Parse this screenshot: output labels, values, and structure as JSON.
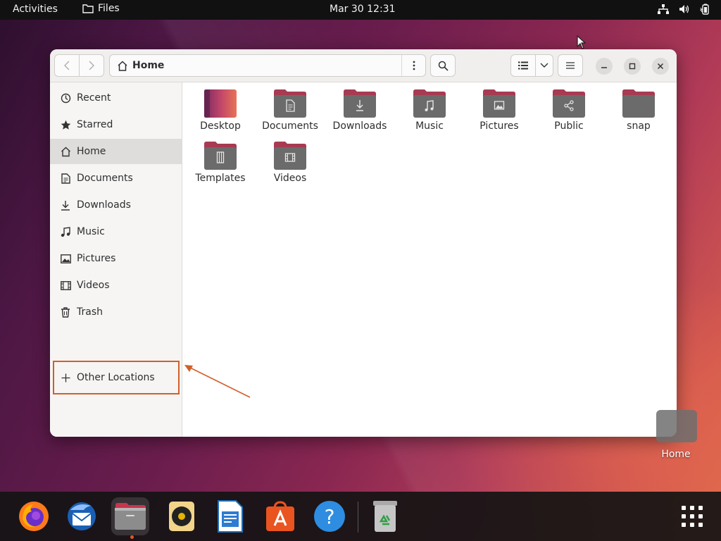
{
  "topbar": {
    "activities": "Activities",
    "app_name": "Files",
    "clock": "Mar 30  12:31",
    "tray_icons": [
      "network-icon",
      "volume-icon",
      "battery-icon"
    ]
  },
  "window": {
    "path": "Home",
    "sidebar": [
      {
        "label": "Recent",
        "icon": "clock-icon"
      },
      {
        "label": "Starred",
        "icon": "star-icon"
      },
      {
        "label": "Home",
        "icon": "home-icon",
        "active": true
      },
      {
        "label": "Documents",
        "icon": "document-icon"
      },
      {
        "label": "Downloads",
        "icon": "download-icon"
      },
      {
        "label": "Music",
        "icon": "music-icon"
      },
      {
        "label": "Pictures",
        "icon": "picture-icon"
      },
      {
        "label": "Videos",
        "icon": "video-icon"
      },
      {
        "label": "Trash",
        "icon": "trash-icon"
      },
      {
        "label": "Other Locations",
        "icon": "plus-icon"
      }
    ],
    "folders": [
      {
        "label": "Desktop",
        "emblem": "none"
      },
      {
        "label": "Documents",
        "emblem": "document"
      },
      {
        "label": "Downloads",
        "emblem": "download"
      },
      {
        "label": "Music",
        "emblem": "music"
      },
      {
        "label": "Pictures",
        "emblem": "picture"
      },
      {
        "label": "Public",
        "emblem": "share"
      },
      {
        "label": "snap",
        "emblem": "none"
      },
      {
        "label": "Templates",
        "emblem": "template"
      },
      {
        "label": "Videos",
        "emblem": "video"
      }
    ]
  },
  "desktop": {
    "home_label": "Home"
  },
  "dock": {
    "apps": [
      "firefox-icon",
      "thunderbird-icon",
      "files-icon",
      "rhythmbox-icon",
      "libreoffice-writer-icon",
      "app-center-icon",
      "help-icon",
      "trash-icon"
    ],
    "grid_icon": "show-apps-icon"
  },
  "colors": {
    "accent": "#e95420",
    "folder_top": "#a83a52",
    "folder_body": "#6b6b6b",
    "highlight_box": "#d25f2a"
  }
}
